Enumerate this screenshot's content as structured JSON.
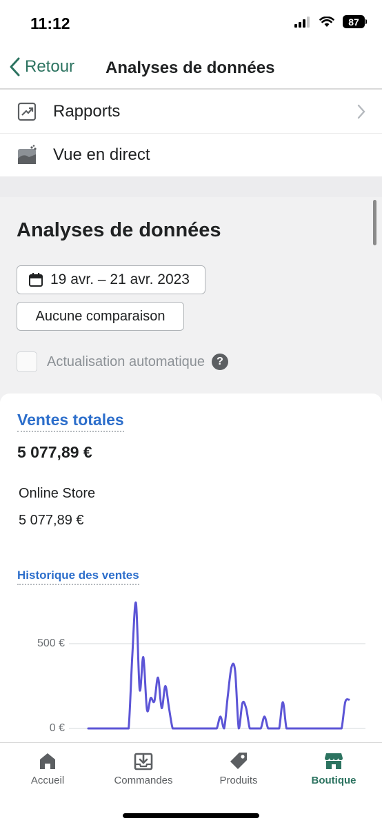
{
  "status_bar": {
    "time": "11:12",
    "battery": "87"
  },
  "nav": {
    "back_label": "Retour",
    "title": "Analyses de données"
  },
  "menu": {
    "items": [
      {
        "label": "Rapports",
        "icon": "report-arrow-icon"
      },
      {
        "label": "Vue en direct",
        "icon": "live-view-icon"
      }
    ]
  },
  "analytics": {
    "title": "Analyses de données",
    "date_range": "19 avr. – 21 avr. 2023",
    "comparison": "Aucune comparaison",
    "auto_refresh_label": "Actualisation automatique",
    "auto_refresh_checked": false,
    "help_glyph": "?"
  },
  "sales": {
    "title": "Ventes totales",
    "total": "5 077,89 €",
    "channel_name": "Online Store",
    "channel_value": "5 077,89 €",
    "history_title": "Historique des ventes"
  },
  "chart_data": {
    "type": "line",
    "title": "Historique des ventes",
    "y_ticks": [
      "500 €",
      "0 €"
    ],
    "y_tick_values": [
      500,
      0
    ],
    "ylim": [
      0,
      750
    ],
    "grid": true,
    "series": [
      {
        "color": "#5c55d6",
        "x": [
          0,
          1,
          2,
          3,
          4,
          5,
          6,
          7,
          8,
          9,
          10,
          11,
          12,
          13,
          14,
          15,
          16,
          17,
          18,
          19,
          20,
          21,
          22,
          23,
          24,
          25,
          26,
          27,
          28,
          29,
          30,
          31,
          32,
          33,
          34,
          35,
          36,
          37,
          38,
          39,
          40,
          41,
          42,
          43,
          44,
          45,
          46,
          47,
          48,
          49,
          50,
          51,
          52,
          53,
          54,
          55,
          56,
          57,
          58,
          59,
          60,
          61,
          62,
          63,
          64,
          65,
          66,
          67,
          68,
          69,
          70,
          71
        ],
        "y": [
          0,
          0,
          0,
          0,
          0,
          0,
          0,
          0,
          0,
          0,
          0,
          0,
          430,
          740,
          230,
          420,
          110,
          180,
          160,
          300,
          120,
          250,
          120,
          0,
          0,
          0,
          0,
          0,
          0,
          0,
          0,
          0,
          0,
          0,
          0,
          0,
          70,
          0,
          190,
          360,
          340,
          0,
          150,
          120,
          0,
          0,
          0,
          0,
          70,
          0,
          0,
          0,
          0,
          155,
          0,
          0,
          0,
          0,
          0,
          0,
          0,
          0,
          0,
          0,
          0,
          0,
          0,
          0,
          0,
          0,
          155,
          170
        ]
      }
    ]
  },
  "tabs": [
    {
      "label": "Accueil",
      "icon": "home-icon",
      "active": false
    },
    {
      "label": "Commandes",
      "icon": "orders-inbox-icon",
      "active": false
    },
    {
      "label": "Produits",
      "icon": "tag-icon",
      "active": false
    },
    {
      "label": "Boutique",
      "icon": "store-icon",
      "active": true
    }
  ],
  "colors": {
    "accent_green": "#2c7360",
    "link_blue": "#2c6ecb",
    "chart_line": "#5c55d6"
  }
}
